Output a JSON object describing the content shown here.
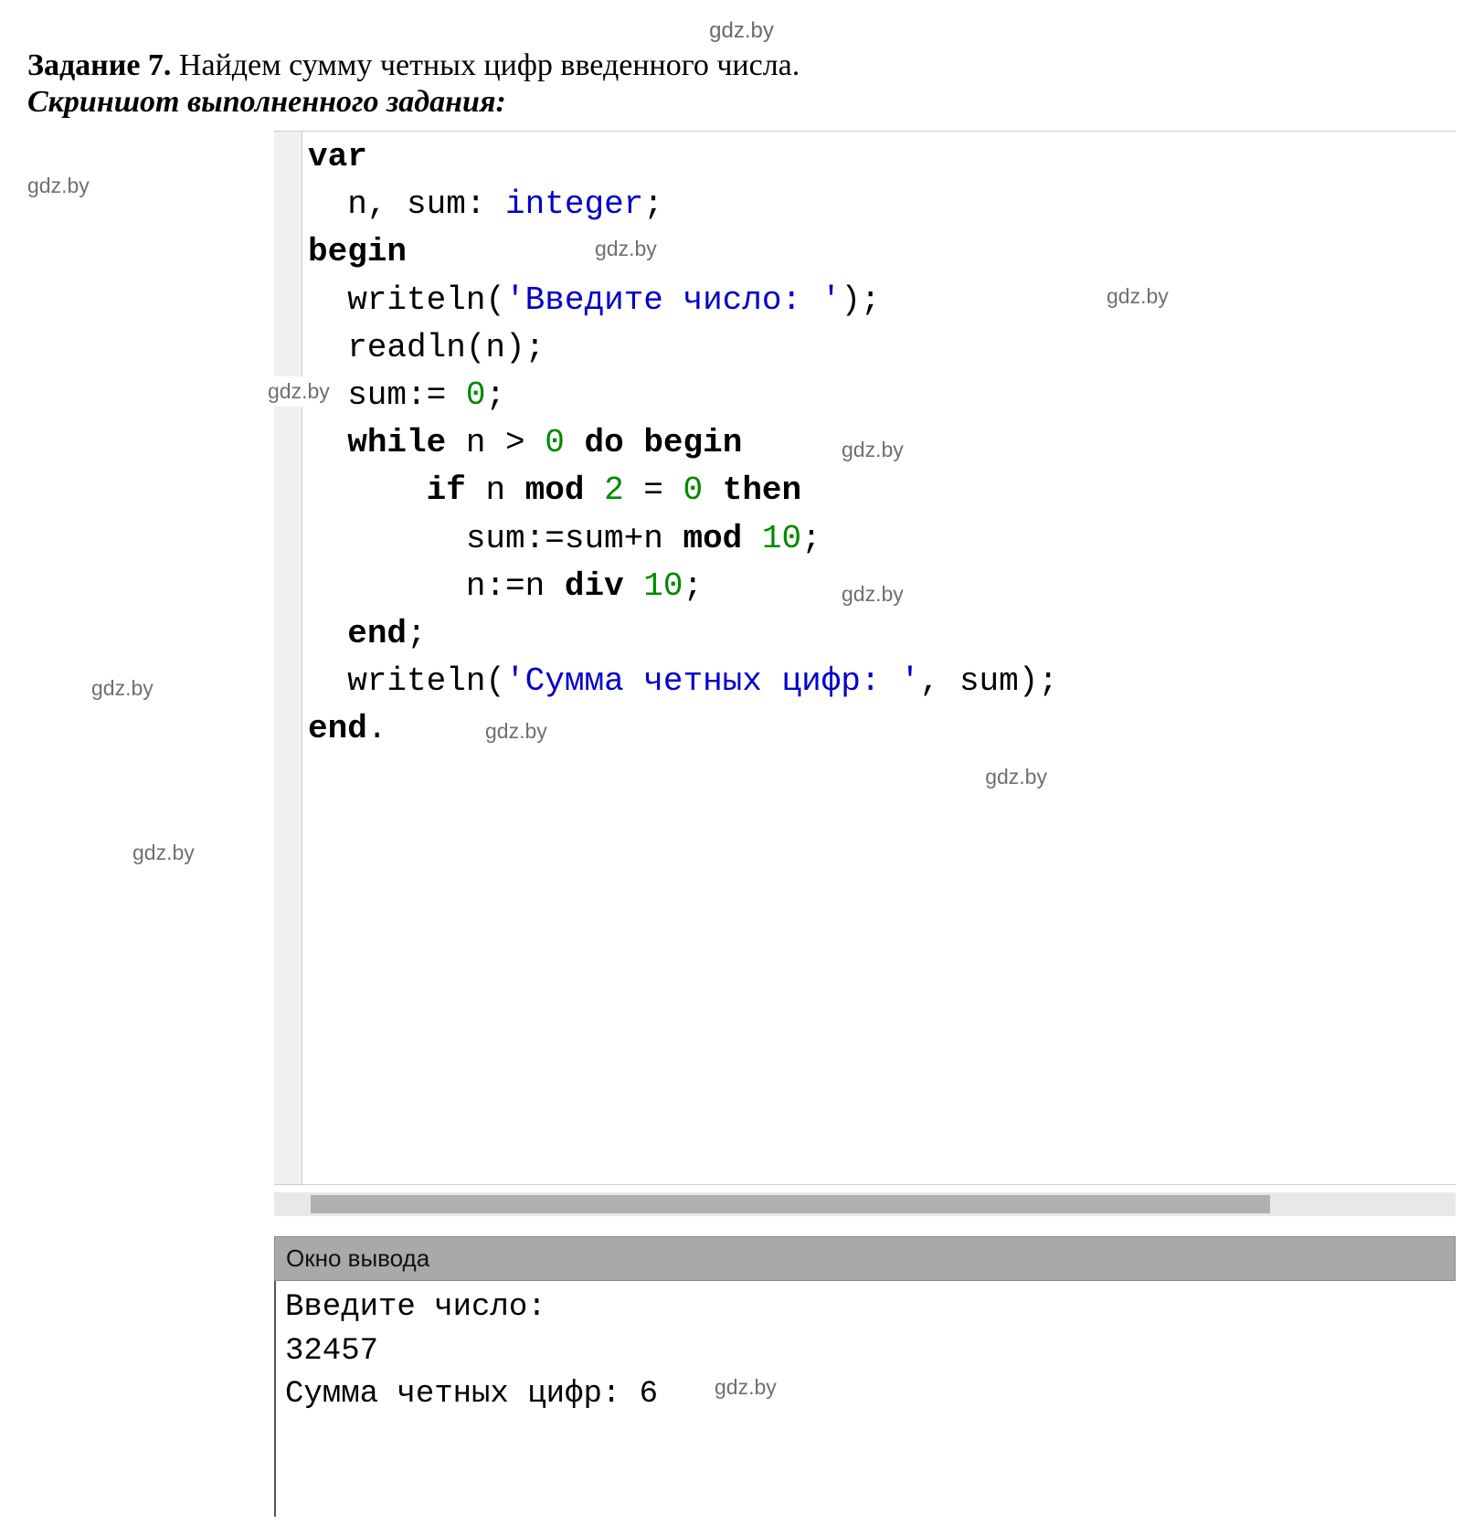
{
  "watermark": "gdz.by",
  "task": {
    "label": "Задание 7.",
    "text": " Найдем сумму четных цифр введенного числа."
  },
  "subtitle": "Скриншот выполненного задания:",
  "code": {
    "l1_var": "var",
    "l2_a": "  n, sum: ",
    "l2_type": "integer",
    "l2_b": ";",
    "l3_begin": "begin",
    "l4_a": "  writeln(",
    "l4_str": "'Введите число: '",
    "l4_b": ");",
    "l5": "  readln(n);",
    "l6_a": "  sum:= ",
    "l6_num": "0",
    "l6_b": ";",
    "l7_a": "  ",
    "l7_while": "while",
    "l7_b": " n > ",
    "l7_num": "0",
    "l7_c": " ",
    "l7_do": "do",
    "l7_d": " ",
    "l7_begin": "begin",
    "l8_a": "      ",
    "l8_if": "if",
    "l8_b": " n ",
    "l8_mod": "mod",
    "l8_c": " ",
    "l8_num2": "2",
    "l8_d": " = ",
    "l8_num0": "0",
    "l8_e": " ",
    "l8_then": "then",
    "l9_a": "        sum:=sum+n ",
    "l9_mod": "mod",
    "l9_b": " ",
    "l9_num": "10",
    "l9_c": ";",
    "l10_a": "        n:=n ",
    "l10_div": "div",
    "l10_b": " ",
    "l10_num": "10",
    "l10_c": ";",
    "l11_a": "  ",
    "l11_end": "end",
    "l11_b": ";",
    "l12_a": "  writeln(",
    "l12_str": "'Сумма четных цифр: '",
    "l12_b": ", sum);",
    "l13_end": "end",
    "l13_dot": "."
  },
  "output": {
    "panel_title": "Окно вывода",
    "line1": "Введите число: ",
    "line2": "32457",
    "line3": "Сумма четных цифр: 6"
  }
}
